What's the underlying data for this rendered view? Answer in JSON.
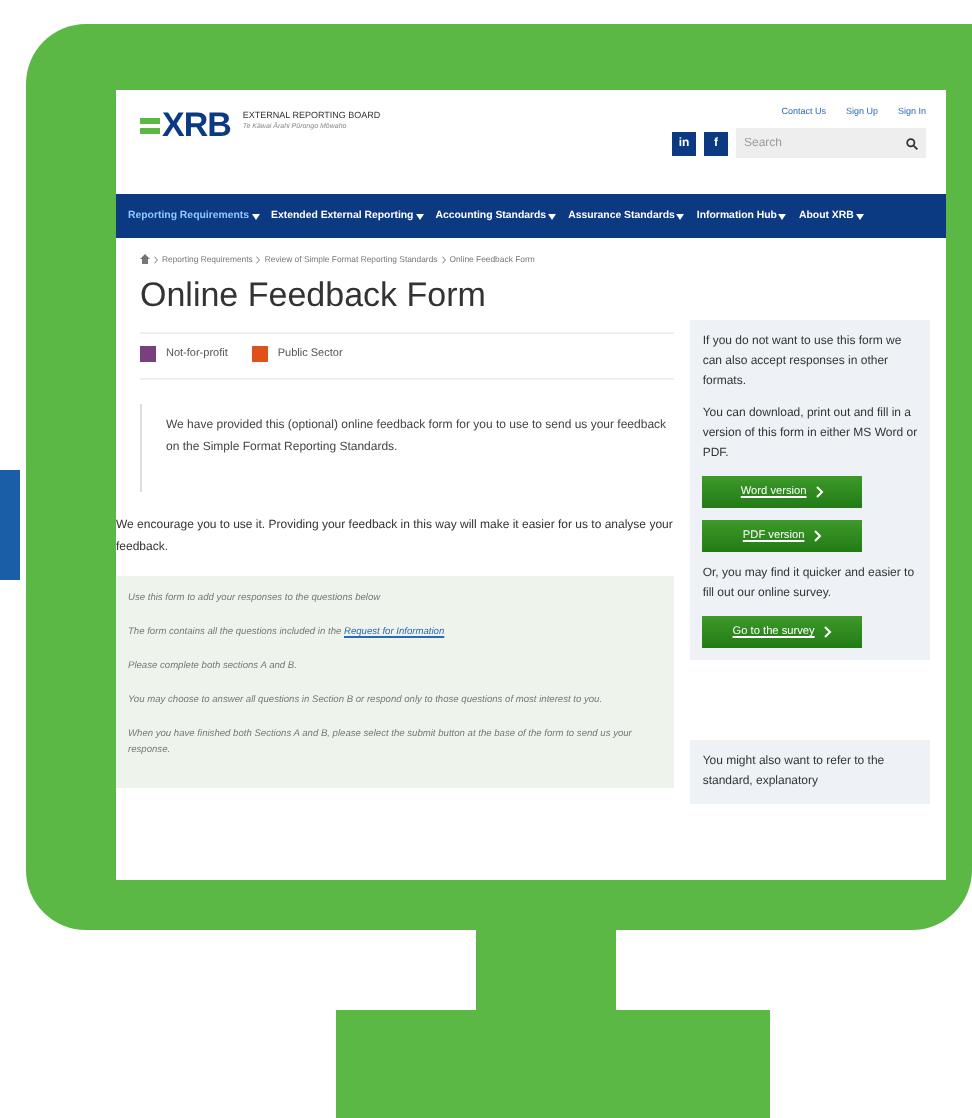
{
  "header": {
    "logo": "XRB",
    "org_name": "EXTERNAL REPORTING BOARD",
    "org_subtitle": "Te Kāwai Ārahi Pūrongo Mōwaho",
    "links": [
      "Contact Us",
      "Sign Up",
      "Sign In"
    ],
    "social": [
      "in",
      "f"
    ],
    "search": {
      "placeholder": "Search"
    }
  },
  "nav": {
    "items": [
      {
        "label": "Reporting Requirements",
        "selected": true
      },
      {
        "label": "Extended External Reporting",
        "selected": false
      },
      {
        "label": "Accounting Standards",
        "selected": false
      },
      {
        "label": "Assurance Standards",
        "selected": false
      },
      {
        "label": "Information Hub",
        "selected": false
      },
      {
        "label": "About XRB",
        "selected": false
      }
    ]
  },
  "breadcrumb": [
    "Reporting Requirements",
    "Review of Simple Format Reporting Standards",
    "Online Feedback Form"
  ],
  "title": "Online Feedback Form",
  "tags": [
    {
      "label": "Not-for-profit",
      "color": "#7b3f7e"
    },
    {
      "label": "Public Sector",
      "color": "#e0501a"
    }
  ],
  "intro": "We have provided this (optional) online feedback form for you to use to send us your feedback on the Simple Format Reporting Standards.",
  "encourage": "We encourage you to use it.  Providing your feedback in this way will make it easier for us to analyse your feedback.",
  "instructions": [
    {
      "text": "Use this form to add your responses to the questions below"
    },
    {
      "text": "The form contains all the questions included in the ",
      "link": "Request for Information"
    },
    {
      "text": "Please complete both sections A and B."
    },
    {
      "text": "You may choose to answer all questions in Section B or respond only to those questions of most interest to you."
    },
    {
      "text": "When you have finished both Sections A and B, please select the submit button at the base of the form to send us your response."
    }
  ],
  "sidebar": [
    {
      "kind": "text",
      "text": "If you do not want to use this form we can also accept responses in other formats."
    },
    {
      "kind": "text",
      "text": "You can download, print out and fill in a version of this form in either MS Word or PDF."
    },
    {
      "kind": "button",
      "text": "Word version"
    },
    {
      "kind": "button",
      "text": "PDF version"
    },
    {
      "kind": "text",
      "text": "Or, you may find it quicker and easier to fill out our online survey."
    },
    {
      "kind": "button",
      "text": "Go to the survey"
    }
  ],
  "sidebar_note": "You might also want to refer to the standard, explanatory"
}
